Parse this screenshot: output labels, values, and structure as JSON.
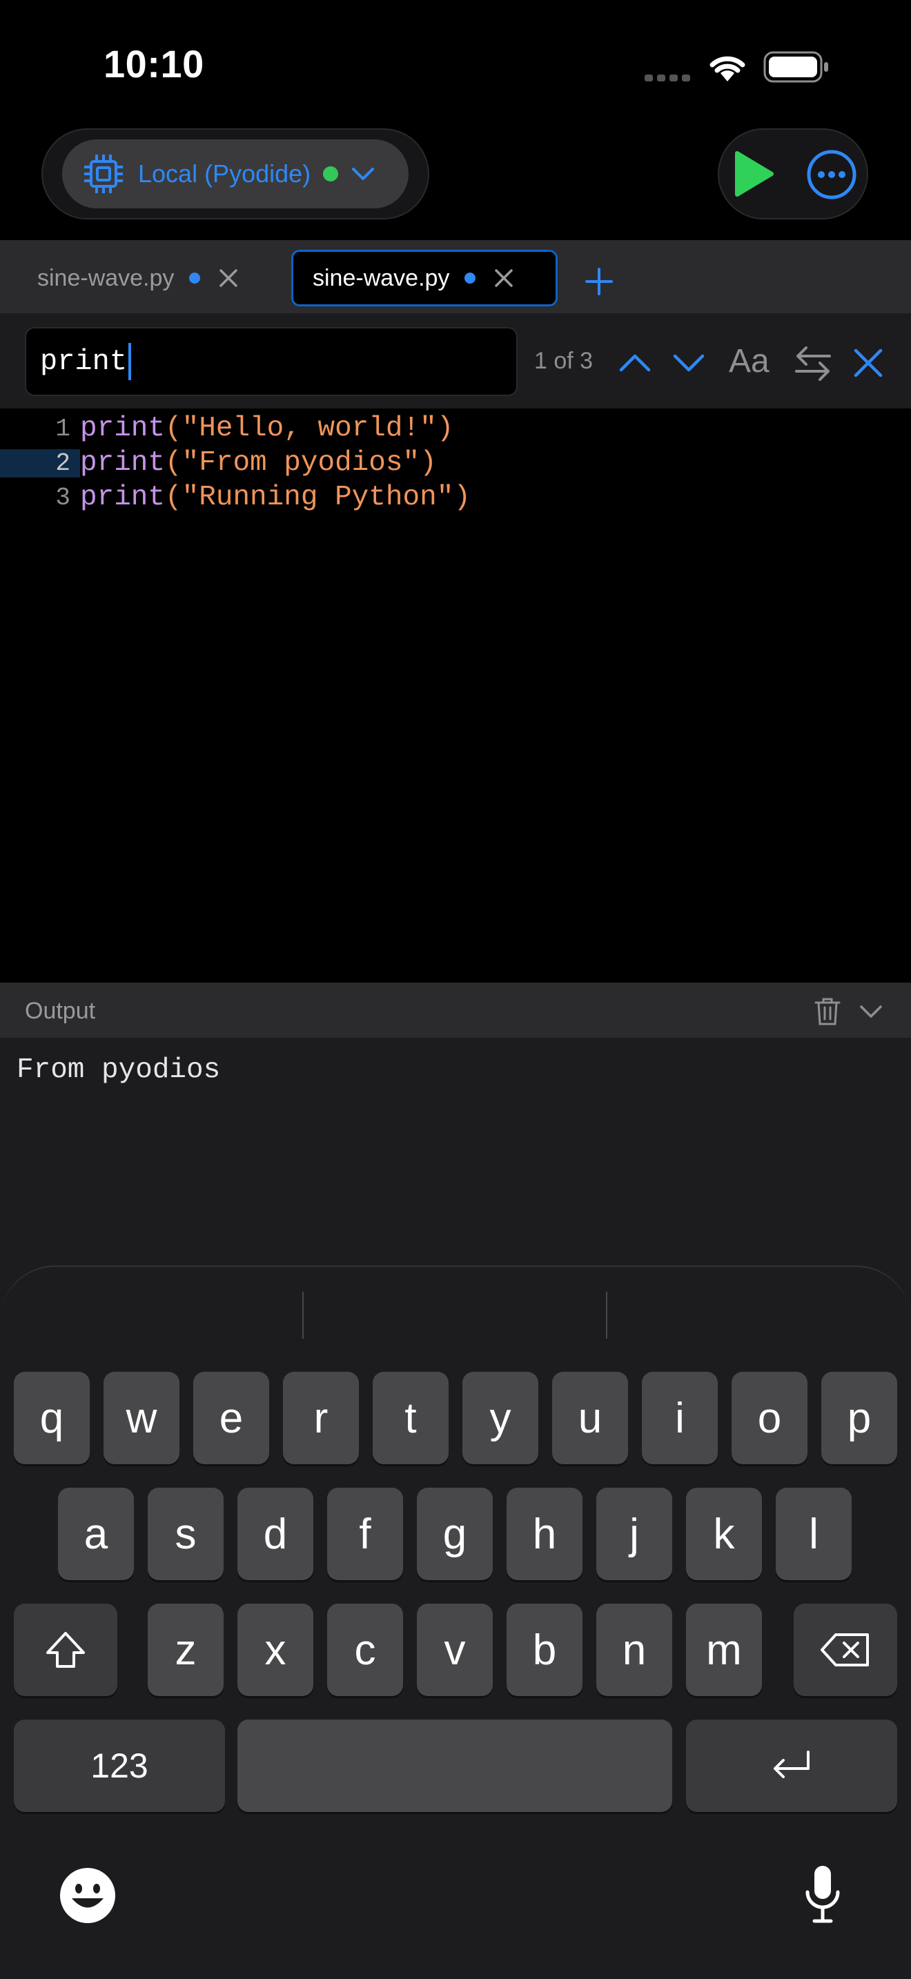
{
  "status_bar": {
    "time": "10:10"
  },
  "toolbar": {
    "runtime_label": "Local (Pyodide)",
    "runtime_status_color": "#34c759",
    "run_icon": "play-icon",
    "more_icon": "ellipsis-circle-icon"
  },
  "tabs": [
    {
      "label": "sine-wave.py",
      "active": false,
      "modified": true
    },
    {
      "label": "sine-wave.py",
      "active": true,
      "modified": true
    }
  ],
  "find": {
    "query": "print",
    "match_count": "1 of 3",
    "case_toggle_label": "Aa"
  },
  "editor": {
    "lines": [
      {
        "number": "1",
        "keyword": "print",
        "open": "(",
        "string": "\"Hello, world!\"",
        "close": ")"
      },
      {
        "number": "2",
        "keyword": "print",
        "open": "(",
        "string": "\"From pyodios\"",
        "close": ")"
      },
      {
        "number": "3",
        "keyword": "print",
        "open": "(",
        "string": "\"Running Python\"",
        "close": ")"
      }
    ],
    "active_line": 2
  },
  "output": {
    "title": "Output",
    "text": "From pyodios"
  },
  "keyboard": {
    "row1": [
      "q",
      "w",
      "e",
      "r",
      "t",
      "y",
      "u",
      "i",
      "o",
      "p"
    ],
    "row2": [
      "a",
      "s",
      "d",
      "f",
      "g",
      "h",
      "j",
      "k",
      "l"
    ],
    "row3": [
      "z",
      "x",
      "c",
      "v",
      "b",
      "n",
      "m"
    ],
    "numbers_label": "123"
  },
  "colors": {
    "accent": "#2f88f5",
    "run": "#30d158",
    "keyword": "#c594e8",
    "string": "#f0955a"
  }
}
